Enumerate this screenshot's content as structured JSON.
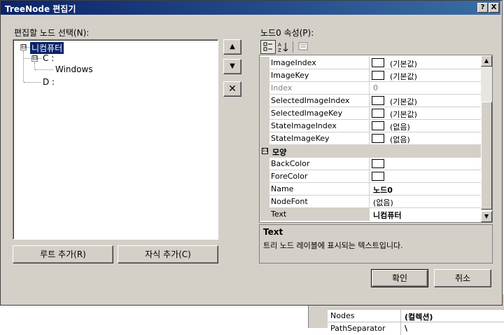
{
  "window": {
    "title": "TreeNode 편집기",
    "help_glyph": "?",
    "close_glyph": "X"
  },
  "tree_panel": {
    "label": "편집할 노드 선택(N):",
    "nodes": [
      {
        "label": "니컴퓨터",
        "selected": true,
        "expander": "⊟"
      },
      {
        "label": "C :",
        "expander": "⊟"
      },
      {
        "label": "Windows"
      },
      {
        "label": "D :"
      }
    ],
    "move_up_glyph": "▲",
    "move_down_glyph": "▼",
    "delete_glyph": "✕",
    "add_root_label": "루트 추가(R)",
    "add_child_label": "자식 추가(C)"
  },
  "property_panel": {
    "label": "노드0 속성(P):",
    "toolbar_icons": [
      "categorized-icon",
      "alphabetical-icon",
      "property-pages-icon"
    ],
    "rows": [
      {
        "name": "ImageIndex",
        "swatch": true,
        "value": "(기본값)"
      },
      {
        "name": "ImageKey",
        "swatch": true,
        "value": "(기본값)"
      },
      {
        "name": "Index",
        "value": "0",
        "readonly": true
      },
      {
        "name": "SelectedImageIndex",
        "swatch": true,
        "value": "(기본값)"
      },
      {
        "name": "SelectedImageKey",
        "swatch": true,
        "value": "(기본값)"
      },
      {
        "name": "StateImageIndex",
        "swatch": true,
        "value": "(없음)"
      },
      {
        "name": "StateImageKey",
        "swatch": true,
        "value": "(없음)"
      }
    ],
    "category": {
      "label": "모양",
      "toggle": "⊟"
    },
    "rows2": [
      {
        "name": "BackColor",
        "swatch": true,
        "value": ""
      },
      {
        "name": "ForeColor",
        "swatch": true,
        "value": ""
      },
      {
        "name": "Name",
        "value": "노드0",
        "bold": true
      },
      {
        "name": "NodeFont",
        "value": "(없음)"
      },
      {
        "name": "Text",
        "value": "니컴퓨터",
        "bold": true,
        "selected": true
      }
    ],
    "description": {
      "title": "Text",
      "text": "트리 노드 레이블에 표시되는 텍스트입니다."
    }
  },
  "buttons": {
    "ok": "확인",
    "cancel": "취소"
  },
  "background_grid": {
    "rows": [
      {
        "name": "Nodes",
        "value": "(컬렉션)"
      },
      {
        "name": "PathSeparator",
        "value": "\\"
      }
    ]
  },
  "colors": {
    "title_start": "#0a246a",
    "title_end": "#3a6ea5",
    "dialog_face": "#d4d0c8",
    "selection": "#0a246a"
  }
}
